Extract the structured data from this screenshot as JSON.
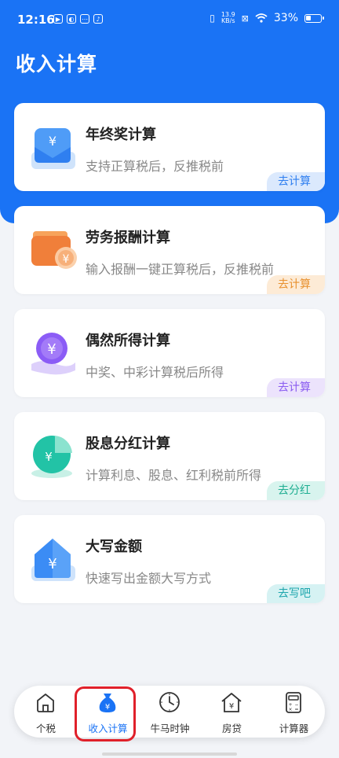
{
  "status_bar": {
    "time": "12:16",
    "net_speed_value": "13.9",
    "net_speed_unit": "KB/s",
    "battery": "33%"
  },
  "page": {
    "title": "收入计算"
  },
  "cards": [
    {
      "title": "年终奖计算",
      "subtitle": "支持正算税后，反推税前",
      "button": "去计算",
      "icon": "envelope-yuan-icon",
      "accent": "#3b8cf5",
      "btn_bg": "#dbe9fd",
      "btn_color": "#2f7ff0"
    },
    {
      "title": "劳务报酬计算",
      "subtitle": "输入报酬一键正算税后，反推税前",
      "button": "去计算",
      "icon": "wallet-yuan-icon",
      "accent": "#f07f3a",
      "btn_bg": "#fdebd6",
      "btn_color": "#e8912f"
    },
    {
      "title": "偶然所得计算",
      "subtitle": "中奖、中彩计算税后所得",
      "button": "去计算",
      "icon": "coin-hand-icon",
      "accent": "#8b5cf6",
      "btn_bg": "#ece3fc",
      "btn_color": "#8a5cf0"
    },
    {
      "title": "股息分红计算",
      "subtitle": "计算利息、股息、红利税前所得",
      "button": "去分红",
      "icon": "pie-chart-yuan-icon",
      "accent": "#22c3a6",
      "btn_bg": "#d8f4ee",
      "btn_color": "#1fae92"
    },
    {
      "title": "大写金额",
      "subtitle": "快速写出金额大写方式",
      "button": "去写吧",
      "icon": "house-yuan-icon",
      "accent": "#3b8cf5",
      "btn_bg": "#d6f2f3",
      "btn_color": "#1ea6ad"
    }
  ],
  "tabs": [
    {
      "label": "个税",
      "icon": "home-icon"
    },
    {
      "label": "收入计算",
      "icon": "money-bag-icon",
      "active": true
    },
    {
      "label": "牛马时钟",
      "icon": "clock-icon"
    },
    {
      "label": "房贷",
      "icon": "house-loan-icon"
    },
    {
      "label": "计算器",
      "icon": "calculator-icon"
    }
  ],
  "colors": {
    "primary": "#1a73f5",
    "background": "#f2f4f8",
    "highlight": "#e0202a"
  }
}
